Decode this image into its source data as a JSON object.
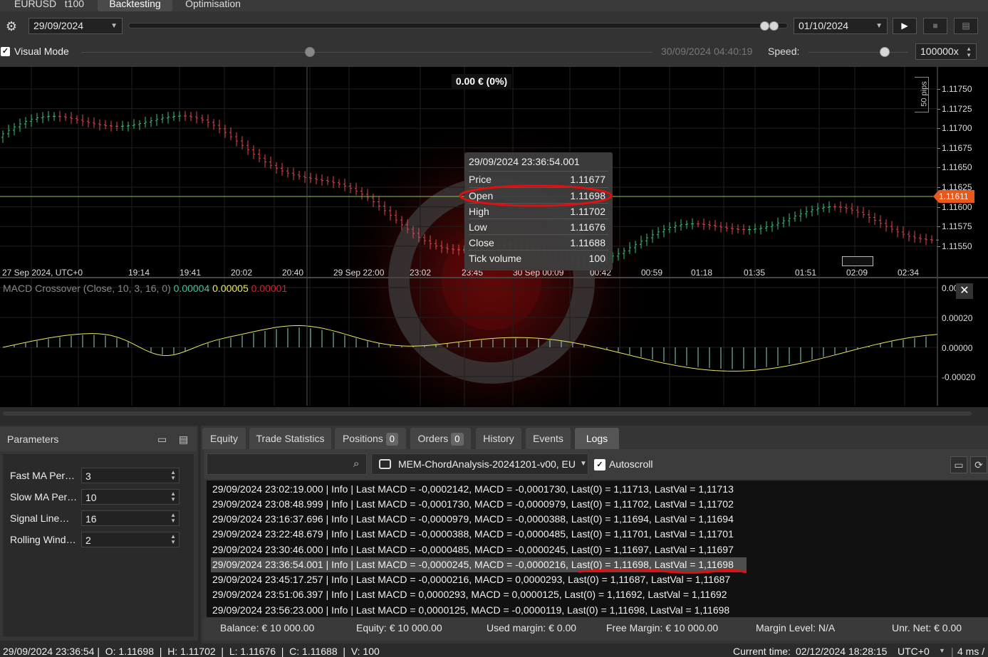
{
  "top": {
    "symbol": "EURUSD",
    "timeframe": "t100",
    "tabs": [
      "Backtesting",
      "Optimisation"
    ]
  },
  "controls": {
    "start_date": "29/09/2024",
    "end_date": "01/10/2024",
    "visual_mode_label": "Visual Mode",
    "current_time": "30/09/2024 04:40:19",
    "speed_label": "Speed:",
    "speed_value": "100000x"
  },
  "chart": {
    "pnl_label": "0.00 € (0%)",
    "pips_label": "50 pips",
    "current_price": "1.11611",
    "price_ticks": [
      "1.11750",
      "1.11725",
      "1.11700",
      "1.11675",
      "1.11650",
      "1.11625",
      "1.11600",
      "1.11575",
      "1.11550"
    ],
    "time_ticks": [
      "27 Sep 2024, UTC+0",
      "19:14",
      "19:41",
      "20:02",
      "20:40",
      "29 Sep 22:00",
      "23:02",
      "23:45",
      "30 Sep 00:09",
      "00:42",
      "00:59",
      "01:18",
      "01:35",
      "01:51",
      "02:09",
      "02:34"
    ],
    "tooltip": {
      "time": "29/09/2024 23:36:54.001",
      "rows": [
        {
          "label": "Price",
          "value": "1.11677"
        },
        {
          "label": "Open",
          "value": "1.11698"
        },
        {
          "label": "High",
          "value": "1.11702"
        },
        {
          "label": "Low",
          "value": "1.11676"
        },
        {
          "label": "Close",
          "value": "1.11688"
        },
        {
          "label": "Tick volume",
          "value": "100"
        }
      ]
    },
    "macd": {
      "title": "MACD Crossover (Close, 10, 3, 16, 0)",
      "v1": "0.00004",
      "v2": "0.00005",
      "v3": "0.00001",
      "ticks": [
        "0.00",
        "0.00020",
        "0.00000",
        "-0.00020"
      ]
    }
  },
  "parameters": {
    "title": "Parameters",
    "rows": [
      {
        "label": "Fast MA Per…",
        "value": "3"
      },
      {
        "label": "Slow MA Per…",
        "value": "10"
      },
      {
        "label": "Signal Line…",
        "value": "16"
      },
      {
        "label": "Rolling Wind…",
        "value": "2"
      }
    ]
  },
  "bottom_tabs": {
    "equity": "Equity",
    "trade_stats": "Trade Statistics",
    "positions": "Positions",
    "positions_count": "0",
    "orders": "Orders",
    "orders_count": "0",
    "history": "History",
    "events": "Events",
    "logs": "Logs"
  },
  "logs": {
    "robot": "MEM-ChordAnalysis-20241201-v00, EU",
    "autoscroll": "Autoscroll",
    "lines": [
      "29/09/2024 23:02:19.000 | Info | Last MACD = -0,0002142, MACD = -0,0001730, Last(0) = 1,11713, LastVal = 1,11713",
      "29/09/2024 23:08:48.999 | Info | Last MACD = -0,0001730, MACD = -0,0000979, Last(0) = 1,11702, LastVal = 1,11702",
      "29/09/2024 23:16:37.696 | Info | Last MACD = -0,0000979, MACD = -0,0000388, Last(0) = 1,11694, LastVal = 1,11694",
      "29/09/2024 23:22:48.679 | Info | Last MACD = -0,0000388, MACD = -0,0000485, Last(0) = 1,11701, LastVal = 1,11701",
      "29/09/2024 23:30:46.000 | Info | Last MACD = -0,0000485, MACD = -0,0000245, Last(0) = 1,11697, LastVal = 1,11697",
      "29/09/2024 23:36:54.001 | Info | Last MACD = -0,0000245, MACD = -0,0000216, Last(0) = 1,11698, LastVal = 1,11698",
      "29/09/2024 23:45:17.257 | Info | Last MACD = -0,0000216, MACD = 0,0000293, Last(0) = 1,11687, LastVal = 1,11687",
      "29/09/2024 23:51:06.397 | Info | Last MACD = 0,0000293, MACD = 0,0000125, Last(0) = 1,11692, LastVal = 1,11692",
      "29/09/2024 23:56:23.000 | Info | Last MACD = 0,0000125, MACD = -0,0000119, Last(0) = 1,11698, LastVal = 1,11698"
    ]
  },
  "stats": {
    "balance": "Balance: € 10 000.00",
    "equity": "Equity: € 10 000.00",
    "used_margin": "Used margin: € 0.00",
    "free_margin": "Free Margin: € 10 000.00",
    "margin_level": "Margin Level: N/A",
    "unr_net": "Unr. Net: € 0.00"
  },
  "status": {
    "bar": "29/09/2024 23:36:54 |  O: 1.11698  |  H: 1.11702  |  L: 1.11676  |  C: 1.11688  |  V: 100",
    "current_time_label": "Current time:",
    "current_time": "02/12/2024 18:28:15",
    "tz": "UTC+0",
    "latency": "4 ms /"
  },
  "colors": {
    "bull": "#3cc47a",
    "bear": "#e04848",
    "price_line": "#8cc63f",
    "price_tag": "#e8581c",
    "annotation": "#e01010",
    "macd_line": "#e8e860",
    "macd_hist": "#8fd7b8"
  }
}
